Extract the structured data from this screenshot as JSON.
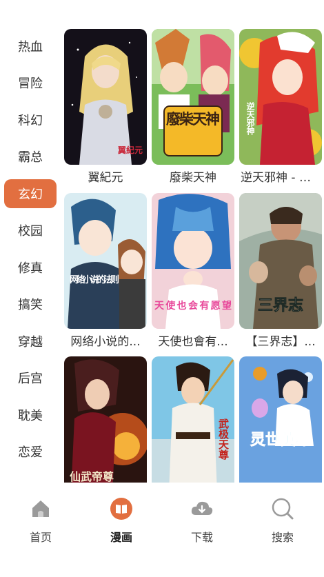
{
  "sidebar": {
    "items": [
      {
        "label": "热血",
        "active": false
      },
      {
        "label": "冒险",
        "active": false
      },
      {
        "label": "科幻",
        "active": false
      },
      {
        "label": "霸总",
        "active": false
      },
      {
        "label": "玄幻",
        "active": true
      },
      {
        "label": "校园",
        "active": false
      },
      {
        "label": "修真",
        "active": false
      },
      {
        "label": "搞笑",
        "active": false
      },
      {
        "label": "穿越",
        "active": false
      },
      {
        "label": "后宫",
        "active": false
      },
      {
        "label": "耽美",
        "active": false
      },
      {
        "label": "恋爱",
        "active": false
      }
    ]
  },
  "comics": [
    {
      "title": "翼紀元",
      "cover_text": "翼紀元"
    },
    {
      "title": "廢柴天神",
      "cover_text": "廢柴天神"
    },
    {
      "title": "逆天邪神 - 二...",
      "cover_text": "逆天邪神"
    },
    {
      "title": "网络小说的...",
      "cover_text": "网络小说的法则"
    },
    {
      "title": "天使也會有...",
      "cover_text": "天使也会有愿望"
    },
    {
      "title": "【三界志】...",
      "cover_text": "三界志"
    },
    {
      "title": "",
      "cover_text": "仙武帝尊"
    },
    {
      "title": "",
      "cover_text": "武极天尊"
    },
    {
      "title": "",
      "cover_text": "灵世英雄"
    }
  ],
  "tabbar": {
    "tabs": [
      {
        "label": "首页",
        "icon": "home-icon",
        "active": false
      },
      {
        "label": "漫画",
        "icon": "book-icon",
        "active": true
      },
      {
        "label": "下载",
        "icon": "cloud-download-icon",
        "active": false
      },
      {
        "label": "搜索",
        "icon": "search-icon",
        "active": false
      }
    ]
  },
  "colors": {
    "accent": "#e26f40",
    "text": "#333333",
    "icon_inactive": "#9a9a9a"
  }
}
